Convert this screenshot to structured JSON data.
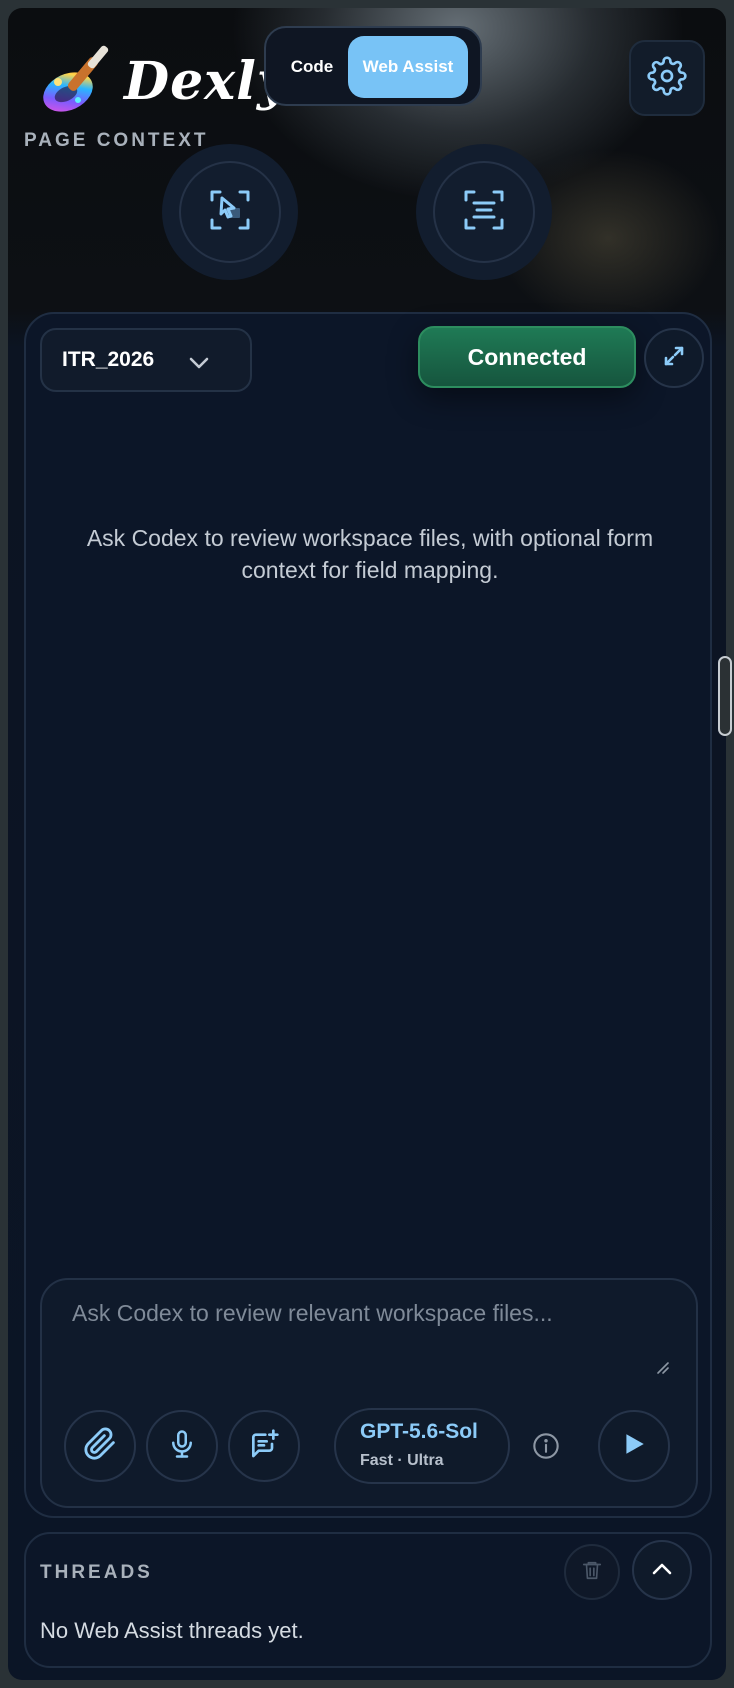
{
  "header": {
    "brand": "Dexly",
    "mode_tabs": [
      {
        "label": "Code",
        "active": false
      },
      {
        "label": "Web Assist",
        "active": true
      }
    ],
    "settings_icon": "gear-icon"
  },
  "page_context": {
    "label": "PAGE CONTEXT",
    "buttons": [
      {
        "icon": "select-element-icon"
      },
      {
        "icon": "scan-text-icon"
      }
    ]
  },
  "panel": {
    "workspace": "ITR_2026",
    "status": "Connected",
    "empty_message": "Ask Codex to review workspace files, with optional form context for field mapping."
  },
  "composer": {
    "placeholder": "Ask Codex to review relevant workspace files...",
    "model_name": "GPT-5.6-Sol",
    "model_sub": "Fast · Ultra"
  },
  "threads": {
    "title": "THREADS",
    "empty": "No Web Assist threads yet."
  },
  "colors": {
    "accent": "#78c3f6",
    "connected": "#1f7a55",
    "panel_bg": "#0c1628"
  }
}
